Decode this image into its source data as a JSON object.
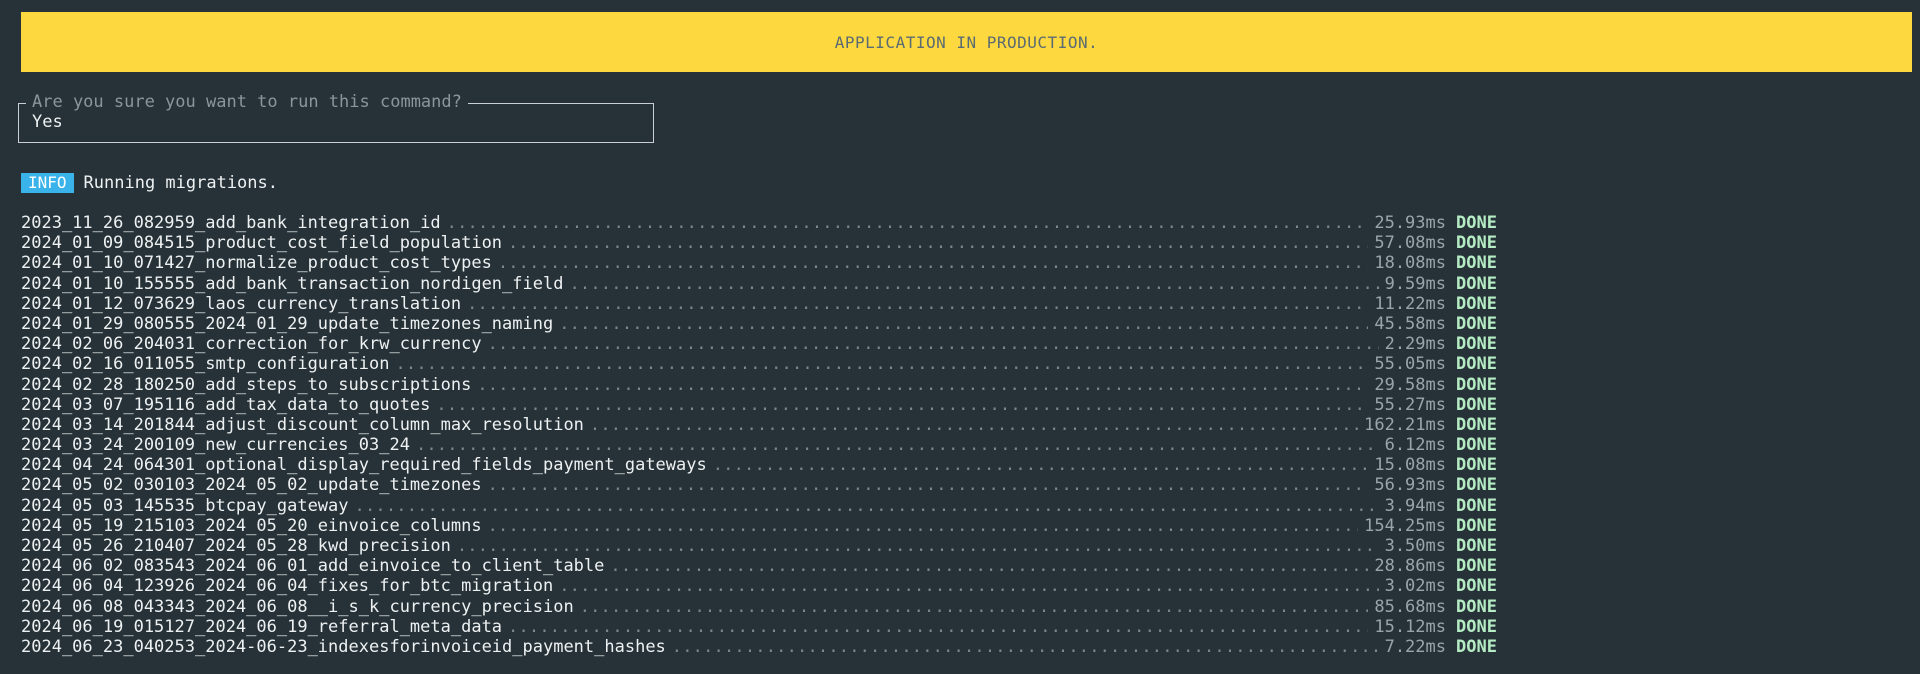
{
  "banner": {
    "text": "APPLICATION IN PRODUCTION."
  },
  "prompt": {
    "question": "Are you sure you want to run this command?",
    "answer": "Yes"
  },
  "info": {
    "badge": "INFO",
    "message": "Running migrations."
  },
  "migrations": [
    {
      "name": "2023_11_26_082959_add_bank_integration_id",
      "time": "25.93ms",
      "status": "DONE"
    },
    {
      "name": "2024_01_09_084515_product_cost_field_population",
      "time": "57.08ms",
      "status": "DONE"
    },
    {
      "name": "2024_01_10_071427_normalize_product_cost_types",
      "time": "18.08ms",
      "status": "DONE"
    },
    {
      "name": "2024_01_10_155555_add_bank_transaction_nordigen_field",
      "time": "9.59ms",
      "status": "DONE"
    },
    {
      "name": "2024_01_12_073629_laos_currency_translation",
      "time": "11.22ms",
      "status": "DONE"
    },
    {
      "name": "2024_01_29_080555_2024_01_29_update_timezones_naming",
      "time": "45.58ms",
      "status": "DONE"
    },
    {
      "name": "2024_02_06_204031_correction_for_krw_currency",
      "time": "2.29ms",
      "status": "DONE"
    },
    {
      "name": "2024_02_16_011055_smtp_configuration",
      "time": "55.05ms",
      "status": "DONE"
    },
    {
      "name": "2024_02_28_180250_add_steps_to_subscriptions",
      "time": "29.58ms",
      "status": "DONE"
    },
    {
      "name": "2024_03_07_195116_add_tax_data_to_quotes",
      "time": "55.27ms",
      "status": "DONE"
    },
    {
      "name": "2024_03_14_201844_adjust_discount_column_max_resolution",
      "time": "162.21ms",
      "status": "DONE"
    },
    {
      "name": "2024_03_24_200109_new_currencies_03_24",
      "time": "6.12ms",
      "status": "DONE"
    },
    {
      "name": "2024_04_24_064301_optional_display_required_fields_payment_gateways",
      "time": "15.08ms",
      "status": "DONE"
    },
    {
      "name": "2024_05_02_030103_2024_05_02_update_timezones",
      "time": "56.93ms",
      "status": "DONE"
    },
    {
      "name": "2024_05_03_145535_btcpay_gateway",
      "time": "3.94ms",
      "status": "DONE"
    },
    {
      "name": "2024_05_19_215103_2024_05_20_einvoice_columns",
      "time": "154.25ms",
      "status": "DONE"
    },
    {
      "name": "2024_05_26_210407_2024_05_28_kwd_precision",
      "time": "3.50ms",
      "status": "DONE"
    },
    {
      "name": "2024_06_02_083543_2024_06_01_add_einvoice_to_client_table",
      "time": "28.86ms",
      "status": "DONE"
    },
    {
      "name": "2024_06_04_123926_2024_06_04_fixes_for_btc_migration",
      "time": "3.02ms",
      "status": "DONE"
    },
    {
      "name": "2024_06_08_043343_2024_06_08__i_s_k_currency_precision",
      "time": "85.68ms",
      "status": "DONE"
    },
    {
      "name": "2024_06_19_015127_2024_06_19_referral_meta_data",
      "time": "15.12ms",
      "status": "DONE"
    },
    {
      "name": "2024_06_23_040253_2024-06-23_indexesforinvoiceid_payment_hashes",
      "time": "7.22ms",
      "status": "DONE"
    }
  ],
  "colors": {
    "background": "#263238",
    "banner": "#fdd83e",
    "info_badge": "#3ab2ea",
    "done": "#b5ecc4"
  }
}
